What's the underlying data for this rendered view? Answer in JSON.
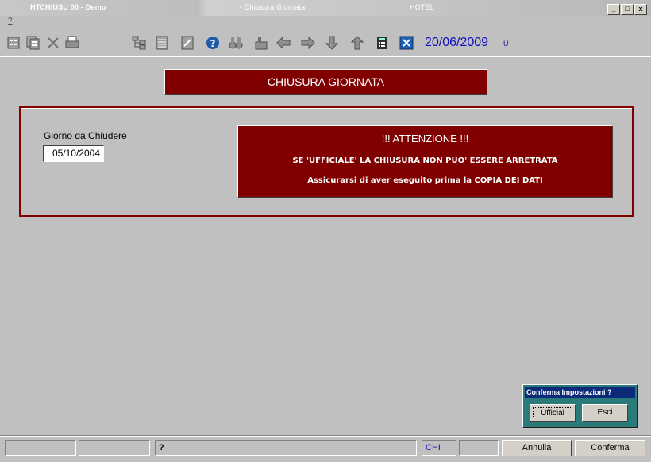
{
  "window": {
    "title_left": "HTCHIUSU 00 - Demo",
    "title_center": "- Chiusura Giornata",
    "title_right": "HOTEL",
    "minimize": "_",
    "restore": "□",
    "close": "x"
  },
  "menu": {
    "item": "?"
  },
  "toolbar": {
    "icons": [
      "form-icon",
      "copy-form-icon",
      "delete-icon",
      "print-icon",
      "tree-icon",
      "list-icon",
      "edit-icon",
      "help-icon",
      "binoculars-icon",
      "upload-icon",
      "arrow-left-icon",
      "arrow-right-icon",
      "arrow-down-icon",
      "arrow-up-icon",
      "calculator-icon",
      "close-box-icon"
    ],
    "date": "20/06/2009",
    "user": "U"
  },
  "header": {
    "title": "CHIUSURA GIORNATA"
  },
  "form": {
    "giorno_label": "Giorno da Chiudere",
    "giorno_value": "05/10/2004"
  },
  "warning": {
    "line1": "!!! ATTENZIONE !!!",
    "line2": "SE 'UFFICIALE' LA CHIUSURA NON PUO' ESSERE ARRETRATA",
    "line3": "Assicurarsi di aver eseguito prima la COPIA DEI DATI"
  },
  "confirm_dialog": {
    "title": "Conferma Impostazioni ?",
    "ufficial_label": "Ufficial",
    "esci_label": "Esci"
  },
  "statusbar": {
    "field1": "",
    "field2": "",
    "message": "?",
    "lang": "CHI",
    "field5": "",
    "annulla_label": "Annulla",
    "conferma_label": "Conferma"
  },
  "colors": {
    "brand_red": "#800000",
    "dialog_teal": "#2a7a7a",
    "date_blue": "#1010c0"
  }
}
